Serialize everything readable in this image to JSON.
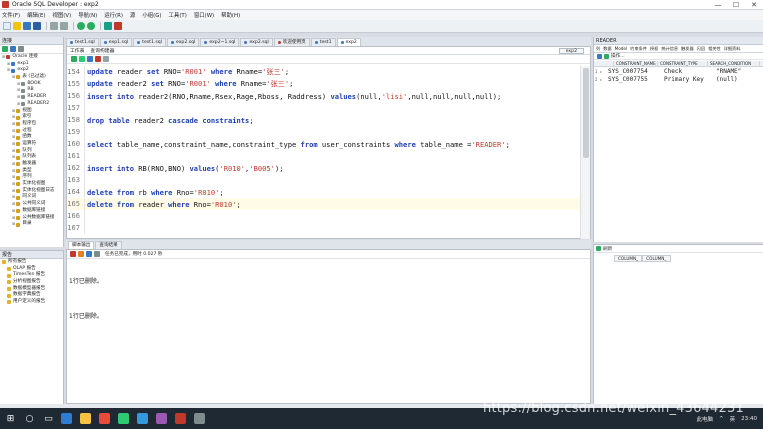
{
  "window": {
    "title": "Oracle SQL Developer : exp2",
    "controls": [
      "—",
      "☐",
      "✕"
    ]
  },
  "menu": [
    "文件(F)",
    "编辑(E)",
    "视图(V)",
    "导航(N)",
    "运行(R)",
    "源",
    "小组(G)",
    "工具(T)",
    "窗口(W)",
    "帮助(H)"
  ],
  "connections_panel": {
    "header": "连接",
    "tree": [
      {
        "label": "Oracle 连接",
        "depth": 0,
        "color": "#c0392b"
      },
      {
        "label": "exp1",
        "depth": 1,
        "color": "#3a78c2"
      },
      {
        "label": "exp2",
        "depth": 1,
        "color": "#3a78c2"
      },
      {
        "label": "表 (已过滤)",
        "depth": 2,
        "color": "#d4a017"
      },
      {
        "label": "BOOK",
        "depth": 3,
        "color": "#7f8c8d"
      },
      {
        "label": "RB",
        "depth": 3,
        "color": "#7f8c8d"
      },
      {
        "label": "READER",
        "depth": 3,
        "color": "#7f8c8d"
      },
      {
        "label": "READER2",
        "depth": 3,
        "color": "#7f8c8d"
      },
      {
        "label": "视图",
        "depth": 2,
        "color": "#d4a017"
      },
      {
        "label": "索引",
        "depth": 2,
        "color": "#d4a017"
      },
      {
        "label": "程序包",
        "depth": 2,
        "color": "#d4a017"
      },
      {
        "label": "过程",
        "depth": 2,
        "color": "#d4a017"
      },
      {
        "label": "函数",
        "depth": 2,
        "color": "#d4a017"
      },
      {
        "label": "运算符",
        "depth": 2,
        "color": "#d4a017"
      },
      {
        "label": "队列",
        "depth": 2,
        "color": "#d4a017"
      },
      {
        "label": "队列表",
        "depth": 2,
        "color": "#d4a017"
      },
      {
        "label": "触发器",
        "depth": 2,
        "color": "#d4a017"
      },
      {
        "label": "类型",
        "depth": 2,
        "color": "#d4a017"
      },
      {
        "label": "序列",
        "depth": 2,
        "color": "#d4a017"
      },
      {
        "label": "实体化视图",
        "depth": 2,
        "color": "#d4a017"
      },
      {
        "label": "实体化视图日志",
        "depth": 2,
        "color": "#d4a017"
      },
      {
        "label": "同义词",
        "depth": 2,
        "color": "#d4a017"
      },
      {
        "label": "公共同义词",
        "depth": 2,
        "color": "#d4a017"
      },
      {
        "label": "数据库链接",
        "depth": 2,
        "color": "#d4a017"
      },
      {
        "label": "公共数据库链接",
        "depth": 2,
        "color": "#d4a017"
      },
      {
        "label": "目录",
        "depth": 2,
        "color": "#d4a017"
      }
    ]
  },
  "reports_panel": {
    "header": "报告",
    "tree": [
      {
        "label": "所有报告",
        "depth": 0
      },
      {
        "label": "OLAP 报告",
        "depth": 1
      },
      {
        "label": "TimesTen 报告",
        "depth": 1
      },
      {
        "label": "分析视图报告",
        "depth": 1
      },
      {
        "label": "数据模型器报告",
        "depth": 1
      },
      {
        "label": "数据字典报告",
        "depth": 1
      },
      {
        "label": "用户定义的报告",
        "depth": 1
      }
    ]
  },
  "editor": {
    "tabs": [
      {
        "label": "test1.sql",
        "color": "#3a78c2",
        "active": false
      },
      {
        "label": "exp1.sql",
        "color": "#3a78c2",
        "active": false
      },
      {
        "label": "test1.sql",
        "color": "#3a78c2",
        "active": false
      },
      {
        "label": "exp2.sql",
        "color": "#3a78c2",
        "active": false
      },
      {
        "label": "exp2~1.sql",
        "color": "#3a78c2",
        "active": false
      },
      {
        "label": "exp2.sql",
        "color": "#3a78c2",
        "active": false
      },
      {
        "label": "欢迎使用页",
        "color": "#c0392b",
        "active": false
      },
      {
        "label": "test1",
        "color": "#3a78c2",
        "active": false
      },
      {
        "label": "exp2",
        "color": "#3a78c2",
        "active": true
      }
    ],
    "subtabs": [
      "工作表",
      "查询构建器"
    ],
    "connection": "exp2",
    "lines": [
      {
        "n": "154",
        "parts": [
          [
            "kw",
            "update"
          ],
          [
            "t",
            " reader "
          ],
          [
            "kw",
            "set"
          ],
          [
            "t",
            " RNO="
          ],
          [
            "s",
            "'R001'"
          ],
          [
            "t",
            " "
          ],
          [
            "kw",
            "where"
          ],
          [
            "t",
            " Rname="
          ],
          [
            "s",
            "'张三'"
          ],
          [
            "t",
            ";"
          ]
        ]
      },
      {
        "n": "155",
        "parts": [
          [
            "kw",
            "update"
          ],
          [
            "t",
            " reader2 "
          ],
          [
            "kw",
            "set"
          ],
          [
            "t",
            " RNO="
          ],
          [
            "s",
            "'R001'"
          ],
          [
            "t",
            " "
          ],
          [
            "kw",
            "where"
          ],
          [
            "t",
            " Rname="
          ],
          [
            "s",
            "'张三'"
          ],
          [
            "t",
            ";"
          ]
        ]
      },
      {
        "n": "156",
        "parts": [
          [
            "kw",
            "insert into"
          ],
          [
            "t",
            " reader2(RNO,Rname,Rsex,Rage,Rboss, Raddress) "
          ],
          [
            "kw",
            "values"
          ],
          [
            "t",
            "(null,"
          ],
          [
            "s",
            "'lisi'"
          ],
          [
            "t",
            ",null,null,null,null);"
          ]
        ]
      },
      {
        "n": "157",
        "parts": []
      },
      {
        "n": "158",
        "parts": [
          [
            "kw",
            "drop table"
          ],
          [
            "t",
            " reader2 "
          ],
          [
            "kw",
            "cascade constraints"
          ],
          [
            "t",
            ";"
          ]
        ]
      },
      {
        "n": "159",
        "parts": []
      },
      {
        "n": "160",
        "parts": [
          [
            "kw",
            "select"
          ],
          [
            "t",
            " table_name,constraint_name,constraint_type "
          ],
          [
            "kw",
            "from"
          ],
          [
            "t",
            " user_constraints "
          ],
          [
            "kw",
            "where"
          ],
          [
            "t",
            " table_name ="
          ],
          [
            "s",
            "'READER'"
          ],
          [
            "t",
            ";"
          ]
        ]
      },
      {
        "n": "161",
        "parts": []
      },
      {
        "n": "162",
        "parts": [
          [
            "kw",
            "insert into"
          ],
          [
            "t",
            " RB(RNO,BNO) "
          ],
          [
            "kw",
            "values"
          ],
          [
            "t",
            "("
          ],
          [
            "s",
            "'R010'"
          ],
          [
            "t",
            ","
          ],
          [
            "s",
            "'B005'"
          ],
          [
            "t",
            ");"
          ]
        ]
      },
      {
        "n": "163",
        "parts": []
      },
      {
        "n": "164",
        "parts": [
          [
            "kw",
            "delete from"
          ],
          [
            "t",
            " rb "
          ],
          [
            "kw",
            "where"
          ],
          [
            "t",
            " Rno="
          ],
          [
            "s",
            "'R010'"
          ],
          [
            "t",
            ";"
          ]
        ]
      },
      {
        "n": "165",
        "parts": [
          [
            "kw",
            "delete from"
          ],
          [
            "t",
            " reader "
          ],
          [
            "kw",
            "where"
          ],
          [
            "t",
            " Rno="
          ],
          [
            "s",
            "'R010'"
          ],
          [
            "t",
            ";"
          ]
        ],
        "highlight": true
      },
      {
        "n": "166",
        "parts": []
      },
      {
        "n": "167",
        "parts": []
      }
    ]
  },
  "output": {
    "tabs": [
      {
        "label": "脚本输出",
        "active": true
      },
      {
        "label": "查询结果",
        "active": false
      }
    ],
    "status": "任务已完成，用时 0.027 秒",
    "messages": [
      "1行已删除。",
      "1行已删除。"
    ]
  },
  "right_panel": {
    "header": "READER",
    "tabs": [
      "列",
      "数据",
      "Model",
      "约束条件",
      "授权",
      "统计信息",
      "触发器",
      "闪回",
      "相关性",
      "详细资料"
    ],
    "tool_label": "操作...",
    "columns": [
      "CONSTRAINT_NAME",
      "CONSTRAINT_TYPE",
      "SEARCH_CONDITION"
    ],
    "rows": [
      [
        "SYS_C007754",
        "Check",
        "\"RNAME\""
      ],
      [
        "SYS_C007755",
        "Primary Key",
        "(null)"
      ]
    ],
    "bottom_label": "刷新",
    "bottom_cols": [
      "COLUMN_",
      "COLUMN_"
    ]
  },
  "taskbar": {
    "tray_items": [
      "此电脑",
      "^",
      "英",
      "23:40"
    ]
  },
  "watermark": "https://blog.csdn.net/weixin_43644231",
  "colors": {
    "keyword": "#1d3fb4",
    "string": "#c0392b",
    "taskbar": "#1f2933"
  }
}
